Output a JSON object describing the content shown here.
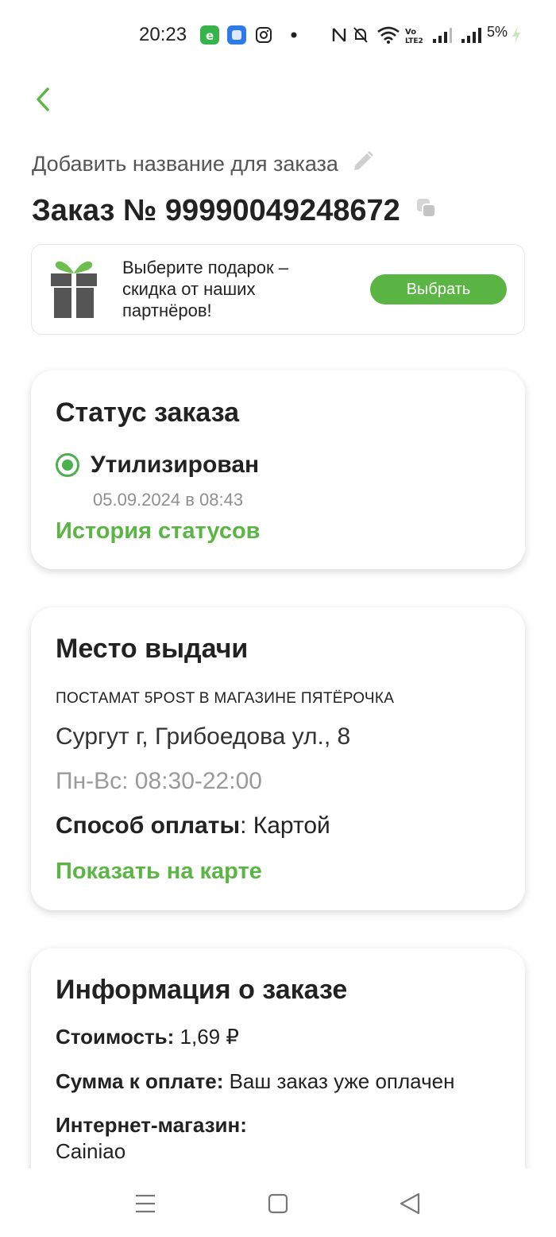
{
  "status_bar": {
    "time": "20:23",
    "app_icons": [
      "e-app-icon",
      "square-app-icon",
      "instagram-icon",
      "dot-icon"
    ],
    "battery": "5%"
  },
  "header": {
    "add_name_label": "Добавить название для заказа",
    "order_number": "Заказ № 99990049248672"
  },
  "gift_banner": {
    "text": "Выберите подарок – скидка от наших партнёров!",
    "button_label": "Выбрать"
  },
  "status_card": {
    "title": "Статус заказа",
    "status": "Утилизирован",
    "date": "05.09.2024 в 08:43",
    "history_link": "История статусов"
  },
  "pickup_card": {
    "title": "Место выдачи",
    "point_type": "ПОСТАМАТ 5POST В МАГАЗИНЕ ПЯТЁРОЧКА",
    "address": "Сургут г, Грибоедова ул., 8",
    "hours": "Пн-Вс: 08:30-22:00",
    "payment_label": "Способ оплаты",
    "payment_value": ": Картой",
    "map_link": "Показать на карте"
  },
  "info_card": {
    "title": "Информация о заказе",
    "cost_label": "Стоимость:",
    "cost_value": " 1,69 ₽",
    "due_label": "Сумма к оплате:",
    "due_value": " Ваш заказ уже оплачен",
    "shop_label": "Интернет-магазин:",
    "shop_value": "Cainiao"
  },
  "colors": {
    "accent": "#5bb545",
    "status_green": "#4caf50",
    "muted": "#9a9a9a"
  }
}
